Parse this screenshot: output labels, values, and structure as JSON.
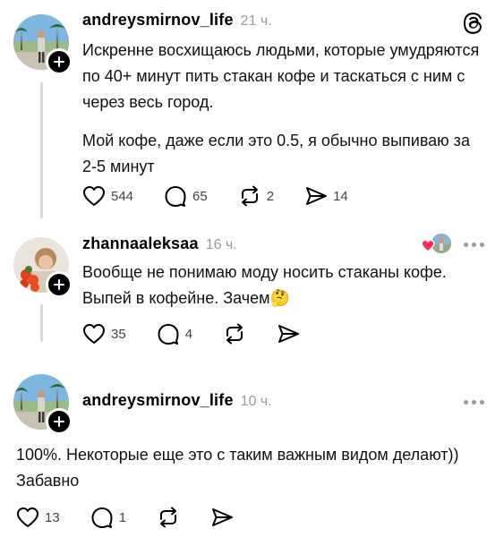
{
  "posts": [
    {
      "username": "andreysmirnov_life",
      "time": "21 ч.",
      "paragraphs": [
        "Искренне восхищаюсь людьми, которые умудряются по 40+ минут пить стакан кофе и таскаться с ним с через весь город.",
        "Мой кофе, даже если это 0.5, я обычно выпиваю за 2-5 минут"
      ],
      "likes": "544",
      "comments": "65",
      "reposts": "2",
      "shares": "14"
    },
    {
      "username": "zhannaaleksaa",
      "time": "16 ч.",
      "paragraphs": [
        "Вообще не понимаю моду носить стаканы кофе. Выпей в кофейне. Зачем🤔"
      ],
      "likes": "35",
      "comments": "4"
    },
    {
      "username": "andreysmirnov_life",
      "time": "10 ч.",
      "paragraphs": [
        "100%. Некоторые еще это с таким важным видом делают)) Забавно"
      ],
      "likes": "13",
      "comments": "1"
    }
  ],
  "icons": {
    "app_logo": "threads-logo-icon",
    "like": "heart-icon",
    "comment": "comment-bubble-icon",
    "repost": "repost-icon",
    "share": "send-icon",
    "more": "more-dots-icon"
  }
}
